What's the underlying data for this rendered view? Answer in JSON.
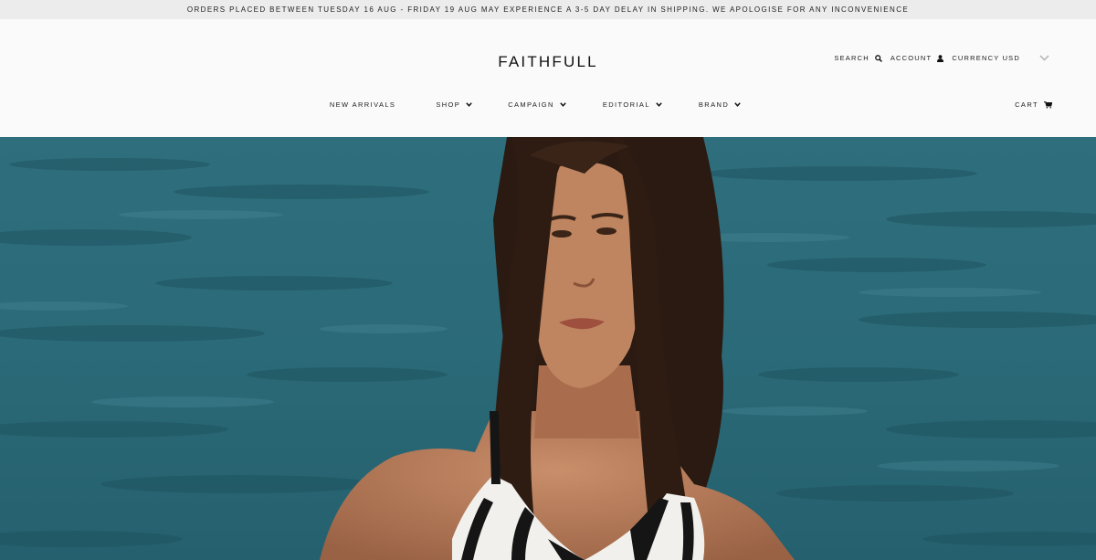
{
  "announcement": {
    "text": "ORDERS PLACED BETWEEN TUESDAY 16 AUG - FRIDAY 19 AUG MAY EXPERIENCE A 3-5 DAY DELAY IN SHIPPING. WE APOLOGISE FOR ANY INCONVENIENCE"
  },
  "header": {
    "logo": "FAITHFULL",
    "utility": {
      "search_label": "SEARCH",
      "search_icon": "search-icon",
      "account_label": "ACCOUNT",
      "account_icon": "user-icon",
      "currency_label": "CURRENCY USD",
      "currency_icon": "chevron-down-icon"
    },
    "nav": [
      {
        "label": "NEW ARRIVALS",
        "has_dropdown": false
      },
      {
        "label": "SHOP",
        "has_dropdown": true
      },
      {
        "label": "CAMPAIGN",
        "has_dropdown": true
      },
      {
        "label": "EDITORIAL",
        "has_dropdown": true
      },
      {
        "label": "BRAND",
        "has_dropdown": true
      }
    ],
    "cart": {
      "label": "CART",
      "icon": "cart-icon"
    }
  },
  "hero": {
    "image": "hero-photo",
    "colors": {
      "sea": "#2e6e7c",
      "sea_dark": "#1f5461",
      "skin": "#b07a5a",
      "hair": "#2a1a12"
    }
  }
}
